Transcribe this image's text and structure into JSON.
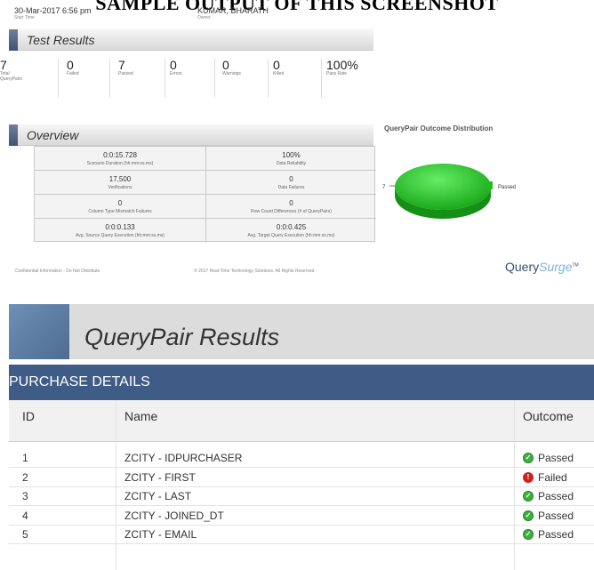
{
  "banner": "SAMPLE OUTPUT OF THIS SCREENSHOT",
  "run": {
    "start_time": "30-Mar-2017 6:56 pm",
    "start_time_label": "Start Time",
    "owner": "KUMAR, BHARATH",
    "owner_label": "Owner"
  },
  "test_results": {
    "title": "Test Results",
    "stats": [
      {
        "value": "7",
        "label": "Total QueryPairs"
      },
      {
        "value": "0",
        "label": "Failed"
      },
      {
        "value": "7",
        "label": "Passed"
      },
      {
        "value": "0",
        "label": "Errors"
      },
      {
        "value": "0",
        "label": "Warnings"
      },
      {
        "value": "0",
        "label": "Killed"
      },
      {
        "value": "100%",
        "label": "Pass Rate"
      }
    ]
  },
  "overview": {
    "title": "Overview",
    "cells": [
      {
        "value": "0:0:15.728",
        "label": "Scenario Duration (hh:mm:ss.ms)"
      },
      {
        "value": "100%",
        "label": "Data Reliability"
      },
      {
        "value": "17,500",
        "label": "Verifications"
      },
      {
        "value": "0",
        "label": "Data Failures"
      },
      {
        "value": "0",
        "label": "Column Type Mismatch Failures"
      },
      {
        "value": "0",
        "label": "Row Count Differences (# of QueryPairs)"
      },
      {
        "value": "0:0:0.133",
        "label": "Avg. Source Query Execution (hh:mm:ss.ms)"
      },
      {
        "value": "0:0:0.425",
        "label": "Avg. Target Query Execution (hh:mm:ss.ms)"
      }
    ]
  },
  "chart_data": {
    "type": "pie",
    "title": "QueryPair Outcome Distribution",
    "categories": [
      "Passed"
    ],
    "values": [
      7
    ],
    "slice_label": "7",
    "legend": "right",
    "colors": [
      "#22bb22"
    ]
  },
  "footer": {
    "left": "Confidential Information - Do Not Distribute",
    "center": "© 2017 Real-Time Technology Solutions. All Rights Reserved.",
    "logo_query": "Query",
    "logo_surge": "Surge",
    "logo_tm": "TM"
  },
  "querypair_results": {
    "title": "QueryPair Results",
    "section": "PURCHASE DETAILS",
    "columns": {
      "id": "ID",
      "name": "Name",
      "outcome": "Outcome"
    },
    "rows": [
      {
        "id": "1",
        "name": "ZCITY - IDPURCHASER",
        "outcome": "Passed",
        "status": "pass"
      },
      {
        "id": "2",
        "name": "ZCITY - FIRST",
        "outcome": "Failed",
        "status": "fail"
      },
      {
        "id": "3",
        "name": "ZCITY - LAST",
        "outcome": "Passed",
        "status": "pass"
      },
      {
        "id": "4",
        "name": "ZCITY - JOINED_DT",
        "outcome": "Passed",
        "status": "pass"
      },
      {
        "id": "5",
        "name": "ZCITY - EMAIL",
        "outcome": "Passed",
        "status": "pass"
      }
    ]
  },
  "colors": {
    "pass": "#3fae3f",
    "fail": "#cc2222",
    "accent": "#3f5c87"
  }
}
